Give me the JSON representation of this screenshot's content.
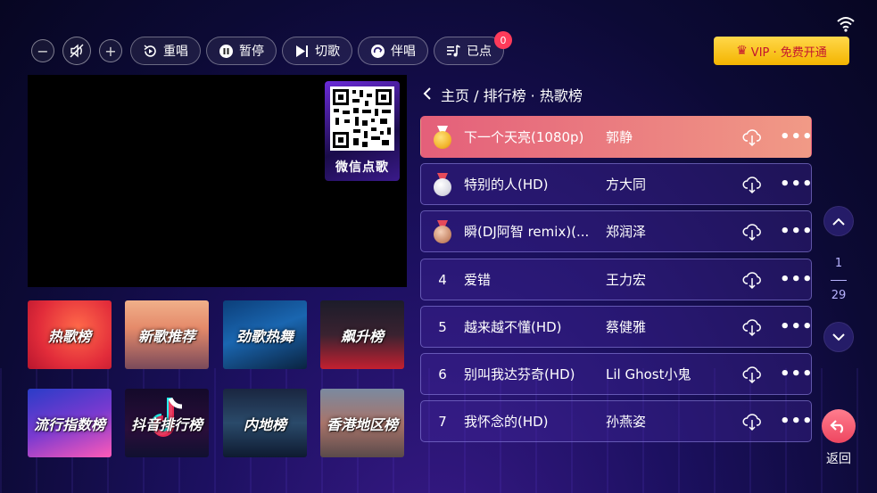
{
  "toolbar": {
    "volume_down": "−",
    "volume_up": "+",
    "replay_label": "重唱",
    "pause_label": "暂停",
    "skip_label": "切歌",
    "accompany_label": "伴唱",
    "ordered_label": "已点",
    "ordered_count": "0",
    "vip_label": "VIP · 免费开通"
  },
  "video": {
    "qr_label": "微信点歌"
  },
  "categories": [
    {
      "label": "热歌榜"
    },
    {
      "label": "新歌推荐"
    },
    {
      "label": "劲歌热舞"
    },
    {
      "label": "飙升榜"
    },
    {
      "label": "流行指数榜"
    },
    {
      "label": "抖音排行榜"
    },
    {
      "label": "内地榜"
    },
    {
      "label": "香港地区榜"
    }
  ],
  "breadcrumb": "主页 / 排行榜 · 热歌榜",
  "songs": [
    {
      "rank": "",
      "title": "下一个天亮(1080p)",
      "singer": "郭静"
    },
    {
      "rank": "",
      "title": "特别的人(HD)",
      "singer": "方大同"
    },
    {
      "rank": "",
      "title": "瞬(DJ阿智 remix)(...",
      "singer": "郑润泽"
    },
    {
      "rank": "4",
      "title": "爱错",
      "singer": "王力宏"
    },
    {
      "rank": "5",
      "title": "越来越不懂(HD)",
      "singer": "蔡健雅"
    },
    {
      "rank": "6",
      "title": "别叫我达芬奇(HD)",
      "singer": "Lil Ghost小鬼"
    },
    {
      "rank": "7",
      "title": "我怀念的(HD)",
      "singer": "孙燕姿"
    }
  ],
  "pager": {
    "current": "1",
    "total": "29"
  },
  "back_label": "返回",
  "colors": {
    "active_row": "#e45f7a",
    "vip": "#f4b400",
    "badge": "#ff3b5a",
    "gold": "#f2b32b",
    "silver": "#d9d9e3",
    "bronze": "#c98a6b"
  }
}
